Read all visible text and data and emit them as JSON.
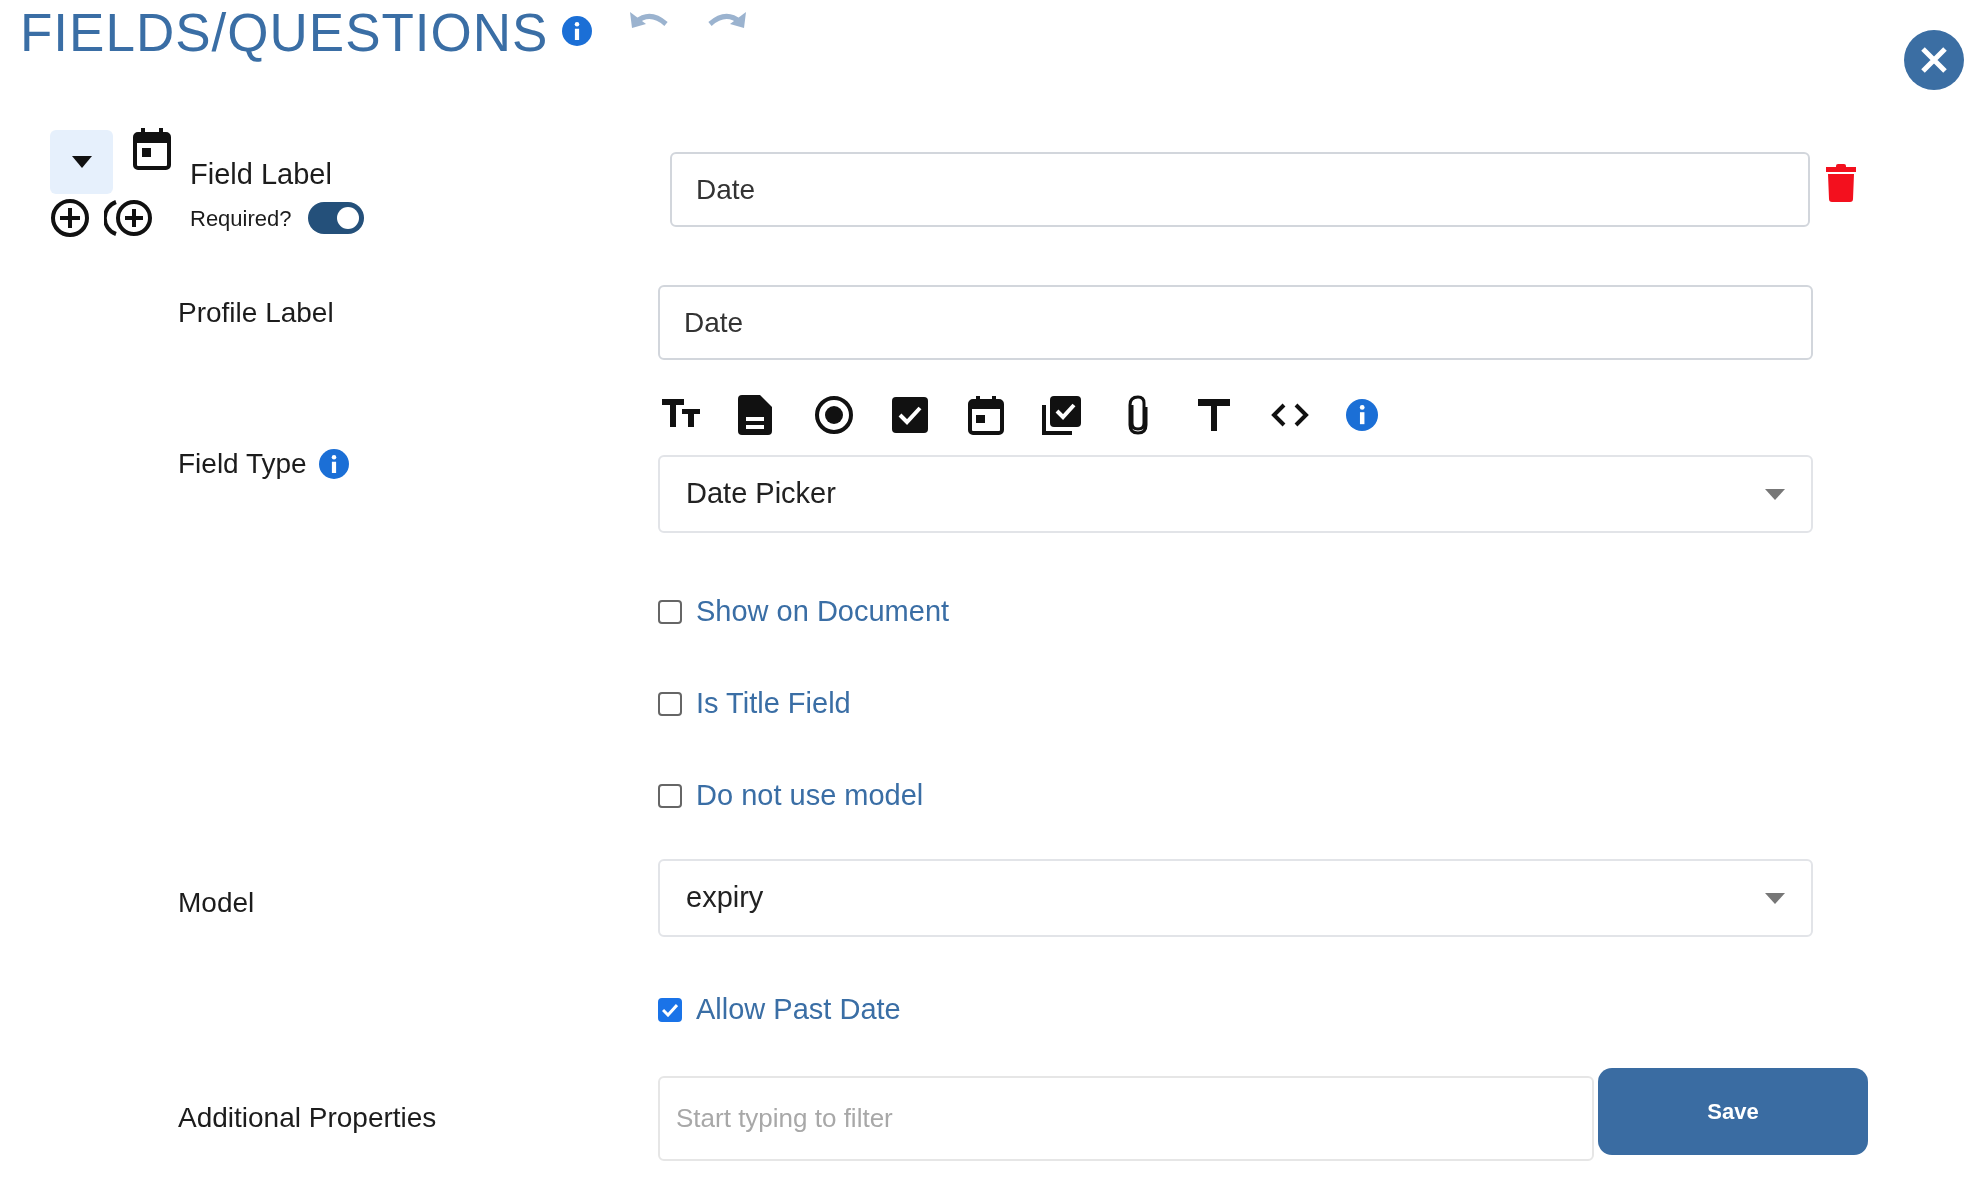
{
  "title": "FIELDS/QUESTIONS",
  "field": {
    "label": "Field Label",
    "value": "Date",
    "required_label": "Required?",
    "required": true
  },
  "rows": [
    {
      "kind": "text",
      "label": "Profile Label",
      "value": "Date"
    },
    {
      "kind": "type",
      "label": "Field Type",
      "value": "Date Picker"
    },
    {
      "kind": "checkbox",
      "label": "Show on Document",
      "checked": false
    },
    {
      "kind": "checkbox",
      "label": "Is Title Field",
      "checked": false
    },
    {
      "kind": "checkbox",
      "label": "Do not use model",
      "checked": false
    },
    {
      "kind": "select",
      "label": "Model",
      "value": "expiry"
    },
    {
      "kind": "checkbox",
      "label": "Allow Past Date",
      "checked": true
    },
    {
      "kind": "filter",
      "label": "Additional Properties",
      "placeholder": "Start typing to filter",
      "button": "Save"
    }
  ]
}
